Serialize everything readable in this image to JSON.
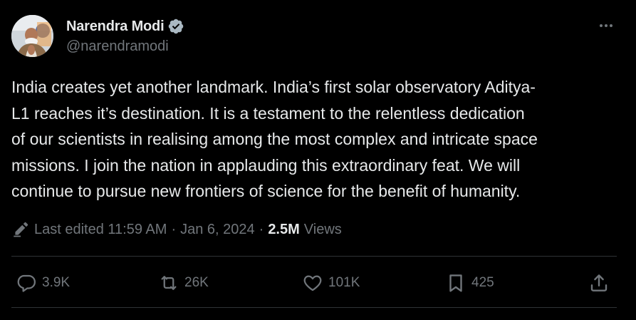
{
  "author": {
    "display_name": "Narendra Modi",
    "handle": "@narendramodi",
    "verified": true
  },
  "tweet": {
    "text_lines": [
      "India creates yet another landmark. India’s first solar observatory Aditya-",
      "L1 reaches it’s destination. It is a testament to the relentless dedication",
      "of our scientists in realising among the most complex and intricate space",
      "missions. I join the nation in applauding this extraordinary feat. We will",
      "continue to pursue new frontiers of science for the benefit of humanity."
    ]
  },
  "meta": {
    "edited_label": "Last edited 11:59 AM",
    "separator": "·",
    "date": "Jan 6, 2024",
    "views_count": "2.5M",
    "views_label": "Views"
  },
  "actions": {
    "reply_count": "3.9K",
    "retweet_count": "26K",
    "like_count": "101K",
    "bookmark_count": "425"
  },
  "icons": {
    "verified": "verified-badge-icon",
    "more": "more-horizontal-icon",
    "edit": "pencil-icon",
    "reply": "reply-bubble-icon",
    "retweet": "retweet-icon",
    "like": "heart-icon",
    "bookmark": "bookmark-icon",
    "share": "share-upload-icon"
  },
  "colors": {
    "background": "#000000",
    "primary_text": "#e7e9ea",
    "secondary_text": "#71767b",
    "divider": "#2f3336",
    "verified_badge": "#aab8c2"
  }
}
